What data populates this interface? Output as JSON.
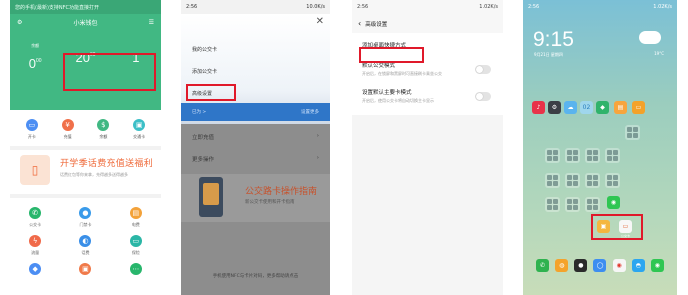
{
  "phone1": {
    "status_text": "您的手机(最新)支持NFC功能直接打开",
    "title": "小米钱包",
    "stats": [
      {
        "label": "余额",
        "value": "0",
        "unit": "00"
      },
      {
        "label": "",
        "value": "20",
        "unit": "00"
      },
      {
        "label": "",
        "value": "1",
        "unit": ""
      }
    ],
    "quick": [
      "开卡",
      "充值",
      "余额",
      "交通卡"
    ],
    "banner_title": "开学季话费充值送福利",
    "banner_sub": "话费红包等你来拿，充得越多送得越多",
    "services": [
      "公交卡",
      "门禁卡",
      "电费",
      "流量",
      "话费",
      "保险",
      "",
      "",
      ""
    ],
    "colors": {
      "accent": "#41b883",
      "banner": "#ef6a3a"
    }
  },
  "phone2": {
    "status_left": "2:56",
    "status_right": "10.0K/s",
    "menu_items": [
      "我的公交卡",
      "添加公交卡",
      "高级设置"
    ],
    "blue_left": "已为 >",
    "blue_right": "设置更多",
    "row_a": "立即充值",
    "row_b": "更多操作",
    "promo_title": "公交路卡操作指南",
    "promo_sub": "新公交卡使用和开卡指南",
    "footer": "手机使用NFC与卡片对码，更多帮助请点击"
  },
  "phone3": {
    "status_left": "2:56",
    "status_right": "1.02K/s",
    "nav_title": "高级设置",
    "items": [
      {
        "title": "添加桌面快捷方式",
        "desc": "",
        "toggle": false
      },
      {
        "title": "默认公交模式",
        "desc": "开启后，在锁屏和黑屏时可直接刷卡乘坐公交",
        "toggle": true
      },
      {
        "title": "设置默认主要卡模式",
        "desc": "开启后，使用公交卡将自动切换主卡显示",
        "toggle": true
      }
    ]
  },
  "phone4": {
    "status_left": "2:56",
    "status_right": "1.02K/s",
    "time": "9:15",
    "date": "9月21日 星期四",
    "temp": "19°C",
    "highlighted_apps": [
      "",
      "公交卡"
    ],
    "dock_apps": [
      "phone",
      "contacts",
      "camera",
      "browser",
      "weibo",
      "qq",
      "wechat"
    ]
  }
}
